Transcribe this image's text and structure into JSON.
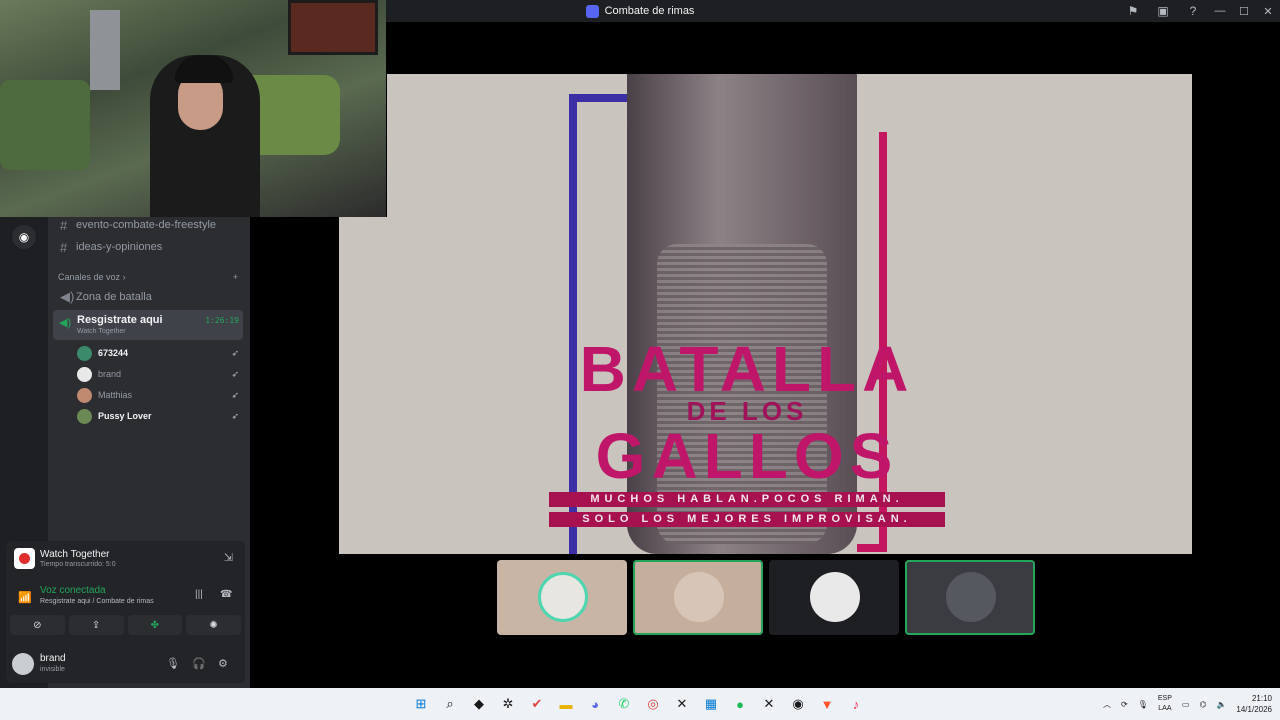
{
  "window": {
    "title": "Combate de rimas"
  },
  "channels": [
    {
      "name": "evento-combate-de-freestyle"
    },
    {
      "name": "ideas-y-opiniones"
    }
  ],
  "voice_category": {
    "label": "Canales de voz",
    "add": "+"
  },
  "voice_channels": [
    {
      "name": "Zona de batalla"
    }
  ],
  "active_voice": {
    "name": "Resgistrate aqui",
    "activity": "Watch Together",
    "timer": "1:26:19"
  },
  "members": [
    {
      "name": "673244",
      "avatar_color": "#3a8a6b"
    },
    {
      "name": "brand",
      "avatar_color": "#e8e8e8"
    },
    {
      "name": "Matthias",
      "avatar_color": "#c08a70"
    },
    {
      "name": "Pussy Lover",
      "avatar_color": "#6b8a55"
    }
  ],
  "activity_panel": {
    "title": "Watch Together",
    "elapsed": "Tiempo transcurrido: 5:0"
  },
  "voice_panel": {
    "title": "Voz conectada",
    "subtitle": "Resgistrate aqui / Combate de rimas"
  },
  "user": {
    "name": "brand",
    "status": "invisible"
  },
  "stream": {
    "line1": "BATALLA",
    "line2": "DE LOS",
    "line3": "GALLOS",
    "slogan1": "MUCHOS HABLAN.POCOS RIMAN.",
    "slogan2": "SOLO LOS MEJORES IMPROVISAN."
  },
  "taskbar": {
    "lang": "ESP",
    "region": "LAA",
    "time": "21:10",
    "date": "14/1/2026"
  },
  "colors": {
    "accent_green": "#23a55a",
    "brand_pink": "#c0166a",
    "brand_blue": "#3c2fa6"
  }
}
